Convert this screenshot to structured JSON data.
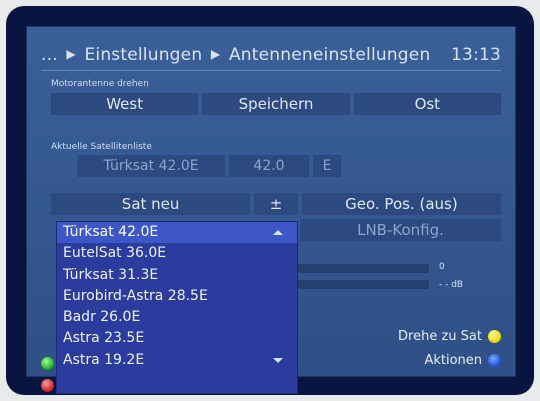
{
  "header": {
    "crumb_prefix": "...",
    "crumb1": "Einstellungen",
    "crumb2": "Antenneneinstellungen",
    "time": "13:13"
  },
  "motor": {
    "caption": "Motorantenne drehen",
    "west": "West",
    "save": "Speichern",
    "east": "Ost"
  },
  "satlist": {
    "caption": "Aktuelle Satellitenliste",
    "name": "Türksat 42.0E",
    "position": "42.0",
    "direction": "E"
  },
  "actions": {
    "sat_new": "Sat neu",
    "down_symbol": "±",
    "geo_pos": "Geo. Pos. (aus)",
    "lnb": "LNB-Konfig."
  },
  "meters": {
    "level": "0",
    "quality": "- - dB"
  },
  "dropdown": {
    "items": [
      "Türksat 42.0E",
      "EutelSat 36.0E",
      "Türksat 31.3E",
      "Eurobird-Astra 28.5E",
      "Badr 26.0E",
      "Astra 23.5E",
      "Astra 19.2E"
    ],
    "selected_index": 0
  },
  "footer": {
    "rotate": "Drehe zu Sat",
    "actions": "Aktionen"
  },
  "colors": {
    "panel": "#345790",
    "dropdown": "#2b3c9e",
    "yellow_key": "#e6d600",
    "blue_key": "#1d4fd6",
    "green_key": "#1da51d",
    "red_key": "#c41d1d"
  }
}
